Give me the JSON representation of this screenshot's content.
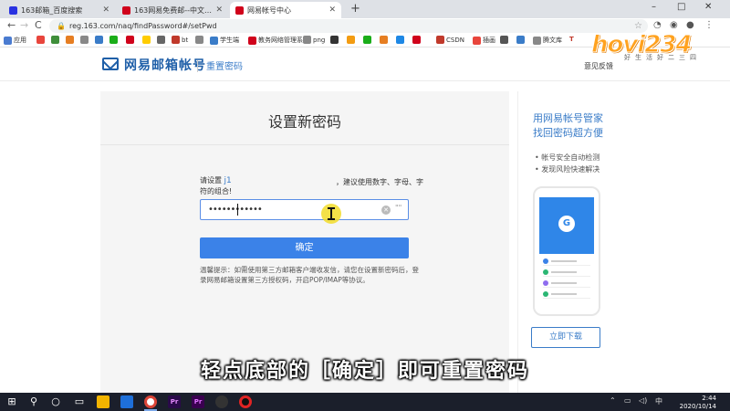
{
  "browser": {
    "tabs": [
      {
        "label": "163邮箱_百度搜索",
        "color": "#2932e1"
      },
      {
        "label": "163网易免费邮--中文邮箱第一品牌",
        "color": "#d0021b"
      },
      {
        "label": "网易帐号中心",
        "color": "#d0021b",
        "active": true
      }
    ],
    "new_tab": "+",
    "window_controls": [
      "–",
      "□",
      "✕"
    ],
    "url": "reg.163.com/naq/findPassword#/setPwd",
    "nav": {
      "back": "←",
      "forward": "→",
      "reload": "C"
    },
    "bookmarks": [
      {
        "label": "应用",
        "color": "#4a7bd0"
      },
      {
        "label": "",
        "color": "#e8453c"
      },
      {
        "label": "",
        "color": "#3f8e3a"
      },
      {
        "label": "",
        "color": "#e67e22"
      },
      {
        "label": "",
        "color": "#888"
      },
      {
        "label": "",
        "color": "#3a7cc8"
      },
      {
        "label": "",
        "color": "#1aad19"
      },
      {
        "label": "",
        "color": "#d0021b"
      },
      {
        "label": "",
        "color": "#ffcc00"
      },
      {
        "label": "",
        "color": "#666"
      },
      {
        "label": "",
        "color": "#2b579a"
      },
      {
        "label": "bt",
        "color": "#c0392b"
      },
      {
        "label": "",
        "color": "#888"
      },
      {
        "label": "学生端",
        "color": "#3a7cc8"
      },
      {
        "label": "",
        "color": "#555"
      },
      {
        "label": "教务网络管理系统",
        "color": "#d0021b"
      },
      {
        "label": "png",
        "color": "#888"
      },
      {
        "label": "",
        "color": "#333"
      },
      {
        "label": "",
        "color": "#f39c12"
      },
      {
        "label": "",
        "color": "#1aad19"
      },
      {
        "label": "",
        "color": "#e67e22"
      },
      {
        "label": "",
        "color": "#1e88e5"
      },
      {
        "label": "",
        "color": "#d0021b"
      },
      {
        "label": "CSDN",
        "color": "#c0392b"
      },
      {
        "label": "插画",
        "color": "#e8453c"
      },
      {
        "label": "",
        "color": "#555"
      },
      {
        "label": "",
        "color": "#3a7cc8"
      },
      {
        "label": "腾文库",
        "color": "#888"
      },
      {
        "label": "T",
        "color": "#c0392b"
      }
    ]
  },
  "watermark": {
    "text": "hovi234",
    "sub": "好生活好二三四"
  },
  "header": {
    "logo": "网易邮箱帐号",
    "page_name": "重置密码",
    "feedback": "意见反馈"
  },
  "form": {
    "title": "设置新密码",
    "hint_prefix": "请设置",
    "hint_highlight": "j1",
    "hint_suffix": "，建议使用数字、字母、字",
    "hint_line2": "符的组合!",
    "password_value": "••••••••••••",
    "password_toggle": "\"\"",
    "confirm_label": "确定",
    "note": "温馨提示：如需使用第三方邮箱客户端收发信，请您在设置新密码后，登录网易邮箱设置第三方授权码，开启POP/IMAP等协议。"
  },
  "side": {
    "title_line1": "用网易帐号管家",
    "title_line2": "找回密码超方便",
    "features": [
      "帐号安全自动检测",
      "发现风险快速解决"
    ],
    "phone_icon": "G",
    "download_label": "立即下载"
  },
  "subtitle": "轻点底部的［确定］即可重置密码",
  "taskbar": {
    "clock_time": "2:44",
    "clock_date": "2020/10/14",
    "tray_lang": "中"
  }
}
